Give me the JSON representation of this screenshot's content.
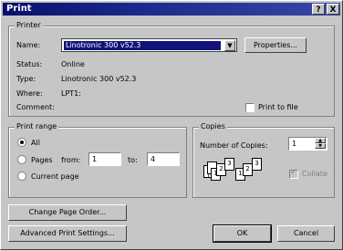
{
  "window": {
    "title": "Print"
  },
  "titlebar": {
    "help_glyph": "?",
    "close_glyph": "X"
  },
  "printer": {
    "group_label": "Printer",
    "name_label": "Name:",
    "name_value": "Linotronic 300 v52.3",
    "properties_button": "Properties...",
    "status_label": "Status:",
    "status_value": "Online",
    "type_label": "Type:",
    "type_value": "Linotronic 300 v52.3",
    "where_label": "Where:",
    "where_value": "LPT1:",
    "comment_label": "Comment:",
    "print_to_file_label": "Print to file"
  },
  "print_range": {
    "group_label": "Print range",
    "all_label": "All",
    "pages_label": "Pages",
    "from_label": "from:",
    "from_value": "1",
    "to_label": "to:",
    "to_value": "4",
    "current_page_label": "Current page",
    "selected": "all"
  },
  "copies": {
    "group_label": "Copies",
    "number_label": "Number of Copies:",
    "number_value": "1",
    "collate_label": "Collate",
    "collate_checked": true,
    "collate_enabled": false
  },
  "buttons": {
    "change_page_order": "Change Page Order...",
    "advanced_print_settings": "Advanced Print Settings...",
    "ok": "OK",
    "cancel": "Cancel"
  },
  "colors": {
    "title_bar": "#08106b",
    "selection": "#11137a",
    "face": "#c6c6c6"
  }
}
